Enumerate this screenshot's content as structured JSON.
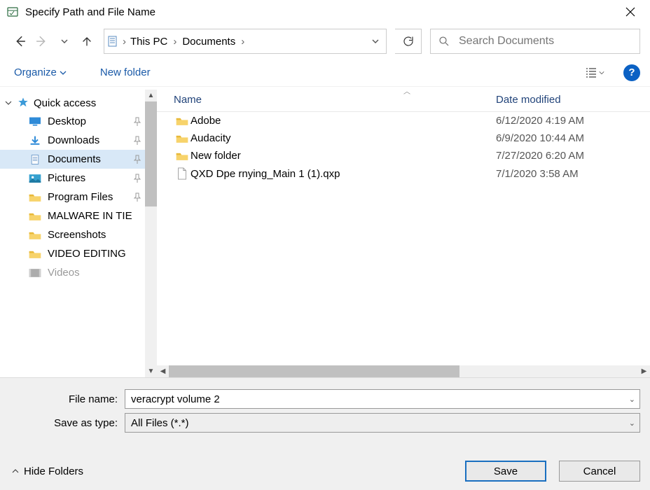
{
  "title": "Specify Path and File Name",
  "breadcrumbs": [
    "This PC",
    "Documents"
  ],
  "search_placeholder": "Search Documents",
  "toolbar": {
    "organize": "Organize",
    "new_folder": "New folder"
  },
  "tree": {
    "header": "Quick access",
    "items": [
      {
        "label": "Desktop",
        "icon": "monitor",
        "pinned": true
      },
      {
        "label": "Downloads",
        "icon": "download",
        "pinned": true
      },
      {
        "label": "Documents",
        "icon": "document",
        "pinned": true,
        "selected": true
      },
      {
        "label": "Pictures",
        "icon": "pictures",
        "pinned": true
      },
      {
        "label": "Program Files",
        "icon": "folder",
        "pinned": true
      },
      {
        "label": "MALWARE IN TIE",
        "icon": "folder",
        "pinned": false
      },
      {
        "label": "Screenshots",
        "icon": "folder",
        "pinned": false
      },
      {
        "label": "VIDEO EDITING",
        "icon": "folder",
        "pinned": false
      },
      {
        "label": "Videos",
        "icon": "video",
        "pinned": false
      }
    ]
  },
  "columns": {
    "name": "Name",
    "date": "Date modified"
  },
  "rows": [
    {
      "icon": "folder",
      "name": "Adobe",
      "date": "6/12/2020 4:19 AM"
    },
    {
      "icon": "folder",
      "name": "Audacity",
      "date": "6/9/2020 10:44 AM"
    },
    {
      "icon": "folder",
      "name": "New folder",
      "date": "7/27/2020 6:20 AM"
    },
    {
      "icon": "file",
      "name": "QXD Dpe rnying_Main 1 (1).qxp",
      "date": "7/1/2020 3:58 AM"
    }
  ],
  "filename_label": "File name:",
  "filename_value": "veracrypt volume 2",
  "type_label": "Save as type:",
  "type_value": "All Files (*.*)",
  "hide_folders": "Hide Folders",
  "save": "Save",
  "cancel": "Cancel"
}
